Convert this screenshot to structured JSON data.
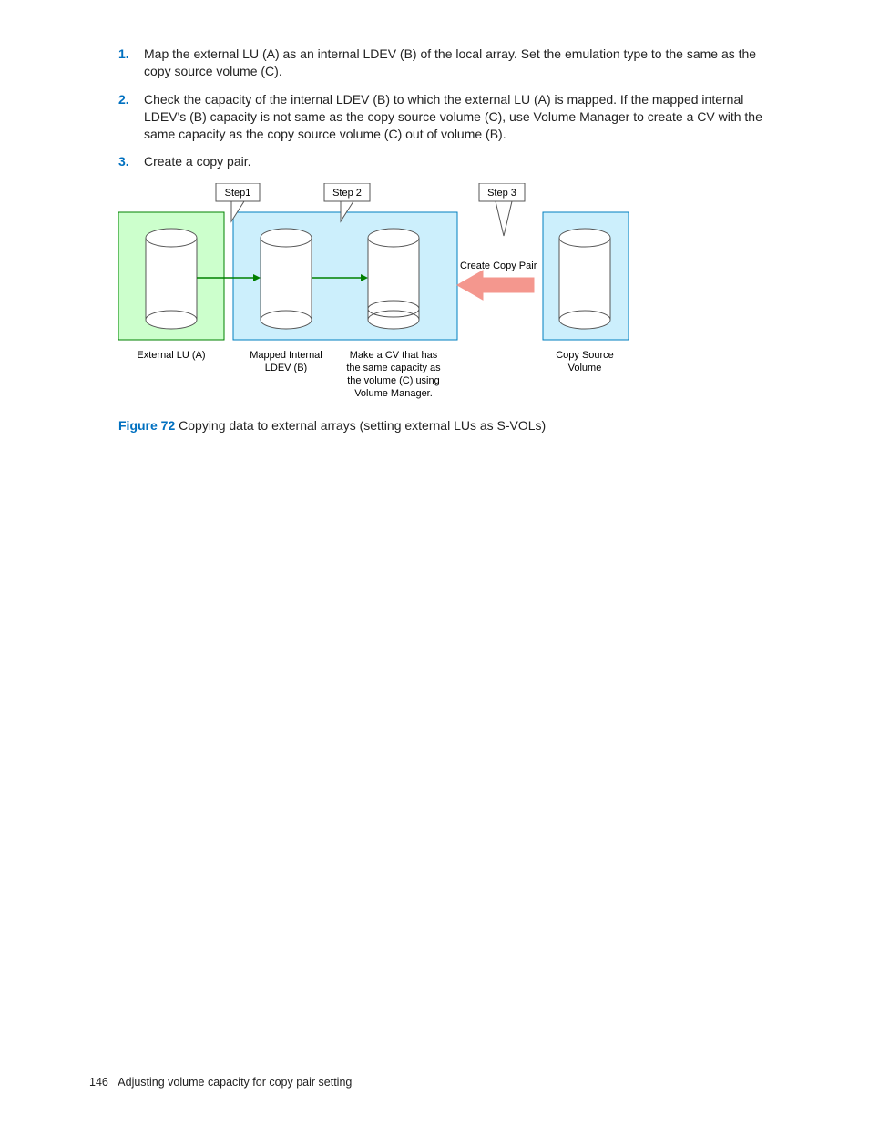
{
  "steps": [
    {
      "n": "1.",
      "text": "Map the external LU (A) as an internal LDEV (B) of the local array. Set the emulation type to the same as the copy source volume (C)."
    },
    {
      "n": "2.",
      "text": "Check the capacity of the internal LDEV (B) to which the external LU (A) is mapped. If the mapped internal LDEV's (B) capacity is not same as the copy source volume (C), use Volume Manager to create a CV with the same capacity as the copy source volume (C) out of volume (B)."
    },
    {
      "n": "3.",
      "text": "Create a copy pair."
    }
  ],
  "diagram": {
    "stepLabels": {
      "s1": "Step1",
      "s2": "Step 2",
      "s3": "Step 3"
    },
    "createPair": "Create Copy Pair",
    "labels": {
      "extLU": "External LU (A)",
      "mapped1": "Mapped Internal",
      "mapped2": "LDEV (B)",
      "makeCV1": "Make a CV that has",
      "makeCV2": "the same capacity as",
      "makeCV3": "the volume (C) using",
      "makeCV4": "Volume Manager.",
      "copySrc1": "Copy Source",
      "copySrc2": "Volume"
    }
  },
  "figure": {
    "num": "Figure 72",
    "caption": " Copying data to external arrays (setting external LUs as S-VOLs)"
  },
  "footer": {
    "page": "146",
    "title": "Adjusting volume capacity for copy pair setting"
  }
}
